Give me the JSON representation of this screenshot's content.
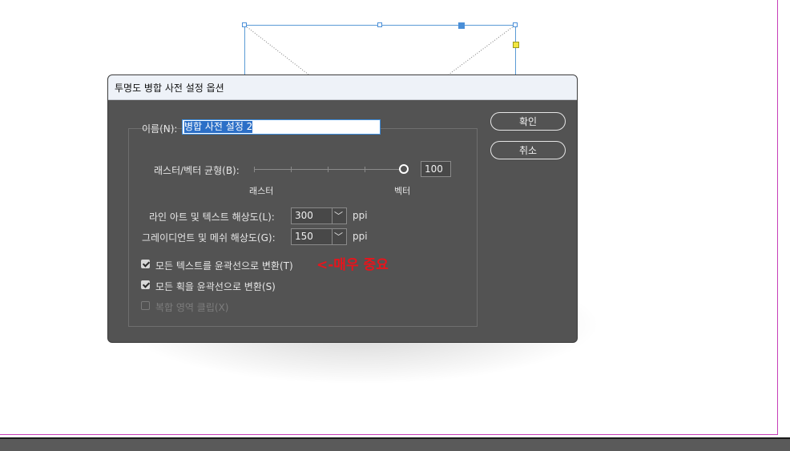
{
  "dialog": {
    "title": "투명도 병합 사전 설정 옵션",
    "name_label": "이름(N):",
    "name_value": "병합 사전 설정 2",
    "balance_label": "래스터/벡터 균형(B):",
    "balance_value": "100",
    "balance_level_percent": 100,
    "raster_label": "래스터",
    "vector_label": "벡터",
    "line_art_label": "라인 아트 및 텍스트 해상도(L):",
    "line_art_value": "300",
    "gradient_mesh_label": "그레이디언트 및 메쉬 해상도(G):",
    "gradient_mesh_value": "150",
    "unit": "ppi",
    "checkboxes": [
      {
        "label": "모든 텍스트를 윤곽선으로 변환(T)",
        "checked": true,
        "enabled": true
      },
      {
        "label": "모든 획을 윤곽선으로 변환(S)",
        "checked": true,
        "enabled": true
      },
      {
        "label": "복합 영역 클립(X)",
        "checked": false,
        "enabled": false
      }
    ],
    "annotation": "<-매우 중요",
    "ok_label": "확인",
    "cancel_label": "취소"
  },
  "colors": {
    "dialog_bg": "#535353",
    "titlebar_bg": "#eef2f8",
    "selection": "#2b6fc7",
    "annotation": "#e8141c",
    "frame": "#5b9bd5",
    "page_margin": "#c63fb8"
  }
}
